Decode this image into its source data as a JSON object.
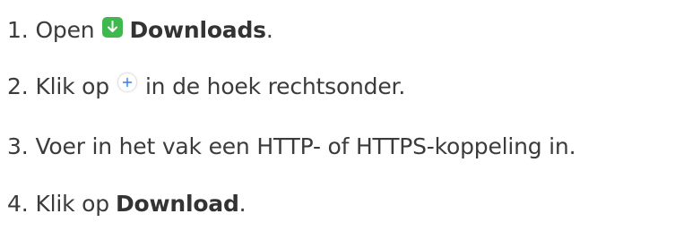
{
  "steps": [
    {
      "number": "1.",
      "text_before": "Open",
      "icon": "downloads-app-icon",
      "bold": "Downloads",
      "text_after": "."
    },
    {
      "number": "2.",
      "text_before": "Klik op",
      "icon": "plus-circle-icon",
      "text_after": "in de hoek rechtsonder."
    },
    {
      "number": "3.",
      "text": "Voer in het vak een HTTP- of HTTPS-koppeling in."
    },
    {
      "number": "4.",
      "text_before": "Klik op",
      "bold": "Download",
      "text_after": "."
    }
  ],
  "colors": {
    "text": "#3b3b3b",
    "downloads_icon_bg": "#3fb94f",
    "plus_icon_accent": "#2f7df6"
  }
}
